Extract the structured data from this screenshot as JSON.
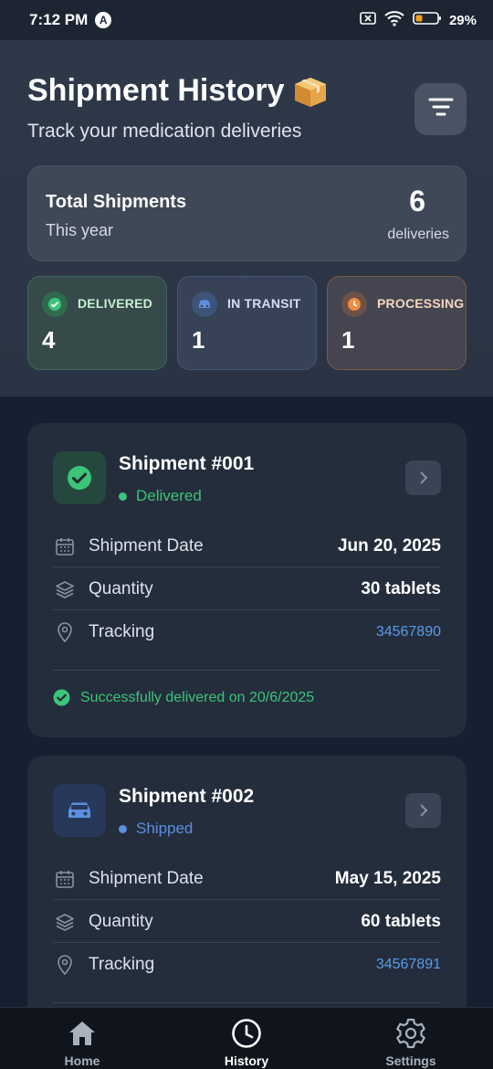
{
  "status_bar": {
    "time": "7:12 PM",
    "app_badge": "A",
    "battery": "29%"
  },
  "header": {
    "title": "Shipment History",
    "title_icon": "package-box-icon",
    "subtitle": "Track your medication deliveries",
    "filter_icon": "filter-icon"
  },
  "summary": {
    "label": "Total Shipments",
    "period": "This year",
    "count": "6",
    "unit": "deliveries"
  },
  "stats": [
    {
      "label": "DELIVERED",
      "value": "4",
      "icon": "check-circle-icon",
      "color": "#3cc47a"
    },
    {
      "label": "IN TRANSIT",
      "value": "1",
      "icon": "car-icon",
      "color": "#5b8fe0"
    },
    {
      "label": "PROCESSING",
      "value": "1",
      "icon": "clock-icon",
      "color": "#f08a3c"
    }
  ],
  "shipments": [
    {
      "title": "Shipment #001",
      "status": "Delivered",
      "status_color": "#3cc47a",
      "icon": "check-circle-icon",
      "rows": [
        {
          "label": "Shipment Date",
          "value": "Jun 20, 2025",
          "icon": "calendar-icon"
        },
        {
          "label": "Quantity",
          "value": "30 tablets",
          "icon": "layers-icon"
        },
        {
          "label": "Tracking",
          "value": "34567890",
          "icon": "location-pin-icon"
        }
      ],
      "footer": "Successfully delivered on 20/6/2025"
    },
    {
      "title": "Shipment #002",
      "status": "Shipped",
      "status_color": "#5b8fe0",
      "icon": "car-icon",
      "rows": [
        {
          "label": "Shipment Date",
          "value": "May 15, 2025",
          "icon": "calendar-icon"
        },
        {
          "label": "Quantity",
          "value": "60 tablets",
          "icon": "layers-icon"
        },
        {
          "label": "Tracking",
          "value": "34567891",
          "icon": "location-pin-icon"
        }
      ]
    }
  ],
  "nav": [
    {
      "label": "Home",
      "icon": "home-icon",
      "active": false
    },
    {
      "label": "History",
      "icon": "clock-icon",
      "active": true
    },
    {
      "label": "Settings",
      "icon": "gear-icon",
      "active": false
    }
  ]
}
